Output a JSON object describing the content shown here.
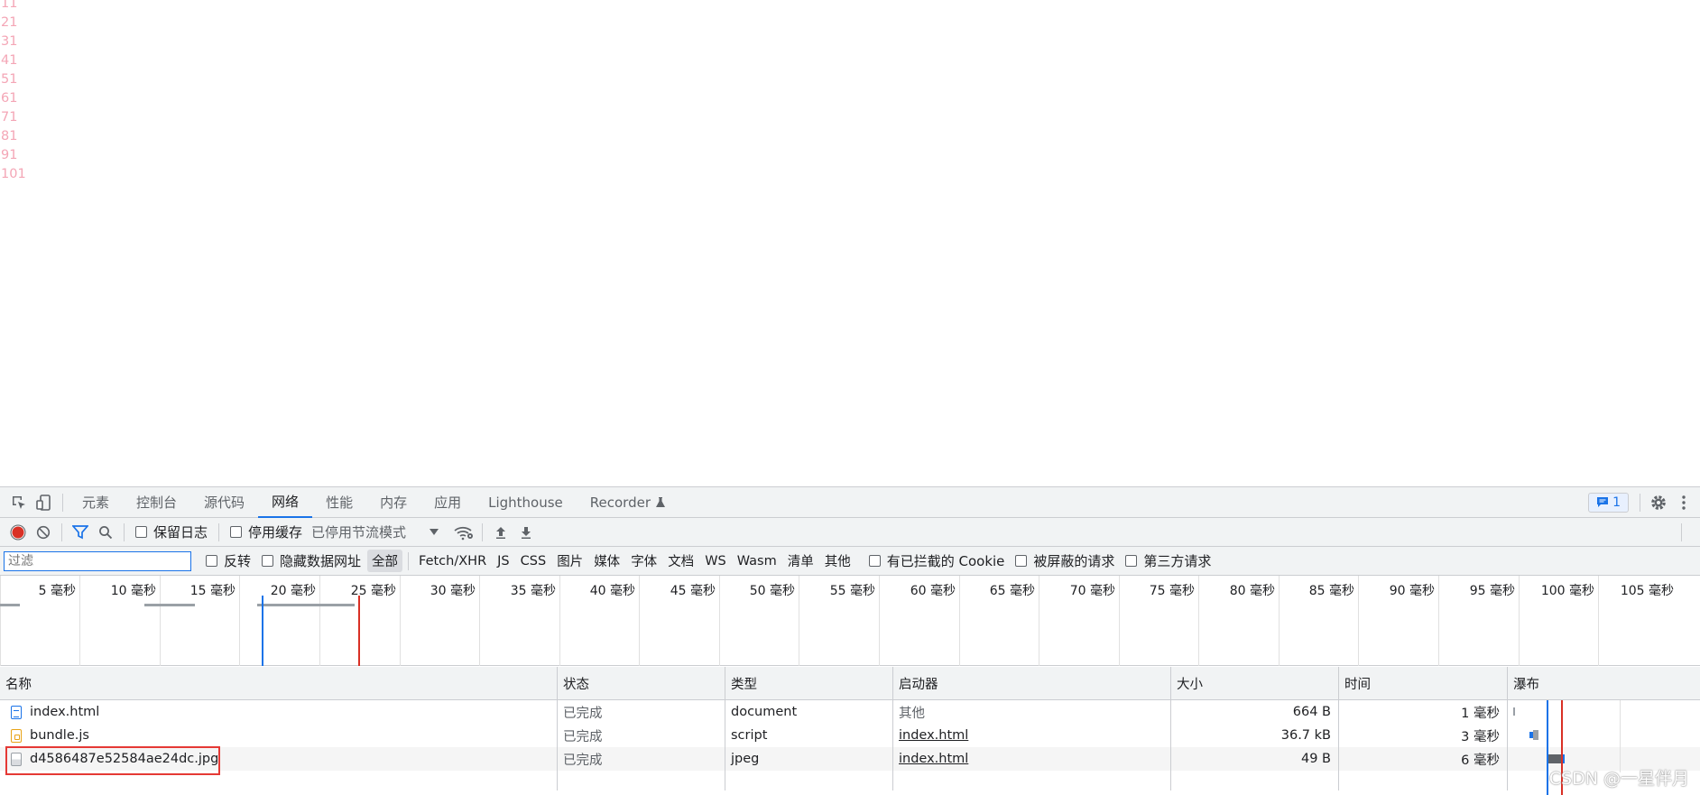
{
  "content": {
    "numbers": [
      "11",
      "21",
      "31",
      "41",
      "51",
      "61",
      "71",
      "81",
      "91",
      "101"
    ]
  },
  "devtools": {
    "tabs": [
      {
        "label": "元素"
      },
      {
        "label": "控制台"
      },
      {
        "label": "源代码"
      },
      {
        "label": "网络"
      },
      {
        "label": "性能"
      },
      {
        "label": "内存"
      },
      {
        "label": "应用"
      },
      {
        "label": "Lighthouse"
      },
      {
        "label": "Recorder"
      }
    ],
    "active_tab": "网络",
    "messages_count": "1",
    "toolbar": {
      "preserve_log": "保留日志",
      "disable_cache": "停用缓存",
      "throttling": "已停用节流模式"
    },
    "filter": {
      "placeholder": "过滤",
      "invert": "反转",
      "hide_data_urls": "隐藏数据网址",
      "types": [
        "全部",
        "Fetch/XHR",
        "JS",
        "CSS",
        "图片",
        "媒体",
        "字体",
        "文档",
        "WS",
        "Wasm",
        "清单",
        "其他"
      ],
      "active_type": "全部",
      "blocked_cookies": "有已拦截的 Cookie",
      "blocked_requests": "被屏蔽的请求",
      "third_party": "第三方请求"
    },
    "timeline": {
      "ticks": [
        "5 毫秒",
        "10 毫秒",
        "15 毫秒",
        "20 毫秒",
        "25 毫秒",
        "30 毫秒",
        "35 毫秒",
        "40 毫秒",
        "45 毫秒",
        "50 毫秒",
        "55 毫秒",
        "60 毫秒",
        "65 毫秒",
        "70 毫秒",
        "75 毫秒",
        "80 毫秒",
        "85 毫秒",
        "90 毫秒",
        "95 毫秒",
        "100 毫秒",
        "105 毫秒"
      ]
    },
    "columns": [
      "名称",
      "状态",
      "类型",
      "启动器",
      "大小",
      "时间",
      "瀑布"
    ],
    "requests": [
      {
        "name": "index.html",
        "status": "已完成",
        "type": "document",
        "initiator": "其他",
        "size": "664 B",
        "time": "1 毫秒"
      },
      {
        "name": "bundle.js",
        "status": "已完成",
        "type": "script",
        "initiator": "index.html",
        "size": "36.7 kB",
        "time": "3 毫秒"
      },
      {
        "name": "d4586487e52584ae24dc.jpg",
        "status": "已完成",
        "type": "jpeg",
        "initiator": "index.html",
        "size": "49 B",
        "time": "6 毫秒"
      }
    ]
  },
  "watermark": "CSDN @一星伴月",
  "colors": {
    "accent": "#1a73e8",
    "record": "#d93025",
    "highlight": "#e53935"
  }
}
